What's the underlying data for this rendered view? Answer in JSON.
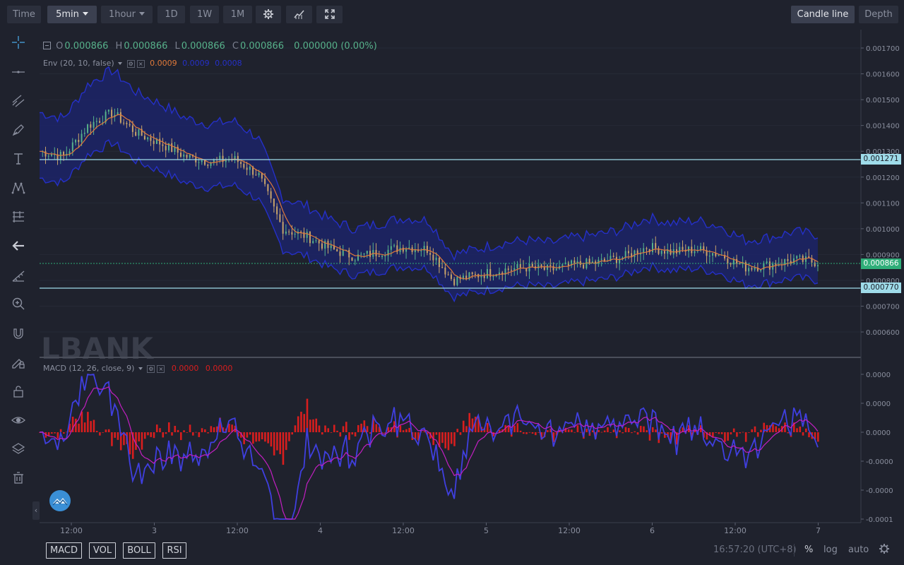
{
  "toolbar": {
    "time_label": "Time",
    "interval_active": "5min",
    "interval_hour": "1hour",
    "interval_1d": "1D",
    "interval_1w": "1W",
    "interval_1m": "1M",
    "candle_line_label": "Candle line",
    "depth_label": "Depth"
  },
  "legend": {
    "o_label": "O",
    "o_value": "0.000866",
    "h_label": "H",
    "h_value": "0.000866",
    "l_label": "L",
    "l_value": "0.000866",
    "c_label": "C",
    "c_value": "0.000866",
    "change": "0.000000 (0.00%)",
    "env_label": "Env (20, 10, false)",
    "env_value_1": "0.0009",
    "env_value_2": "0.0009",
    "env_value_3": "0.0008",
    "macd_label": "MACD (12, 26, close, 9)",
    "macd_value_1": "0.0000",
    "macd_value_2": "0.0000"
  },
  "price_axis": {
    "ticks": [
      "0.001700",
      "0.001600",
      "0.001500",
      "0.001400",
      "0.001300",
      "0.001200",
      "0.001100",
      "0.001000",
      "0.000900",
      "0.000800",
      "0.000700",
      "0.000600"
    ],
    "tag_upper": "0.001271",
    "tag_current": "0.000866",
    "tag_lower": "0.000770"
  },
  "macd_axis": {
    "ticks": [
      "0.0000",
      "0.0000",
      "0.0000",
      "-0.0000",
      "-0.0000",
      "-0.0001"
    ]
  },
  "time_axis": {
    "ticks": [
      "12:00",
      "3",
      "12:00",
      "4",
      "12:00",
      "5",
      "12:00",
      "6",
      "12:00",
      "7"
    ]
  },
  "watermark": "LBANK",
  "bottom": {
    "macd_btn": "MACD",
    "vol_btn": "VOL",
    "boll_btn": "BOLL",
    "rsi_btn": "RSI",
    "clock": "16:57:20 (UTC+8)",
    "percent": "%",
    "log": "log",
    "auto": "auto"
  },
  "colors": {
    "background": "#1f222d",
    "envelope_fill": "#1c2470",
    "envelope_line": "#2530c8",
    "price_up": "#57b28b",
    "price_down": "#c9a46a",
    "ma_line": "#e0793a",
    "macd_hist": "#d81e1e",
    "macd_line": "#3f3fe0",
    "signal_line": "#c21fc2",
    "hline": "#9fdcea",
    "current_price": "#2fae79"
  },
  "chart_data": {
    "type": "line",
    "pair_price_axis": {
      "min": 0.00055,
      "max": 0.00175,
      "log": false
    },
    "horizontal_lines": [
      0.001271,
      0.00077
    ],
    "current_price": 0.000866,
    "x": [
      "12:00",
      "",
      "3",
      "",
      "12:00",
      "",
      "4",
      "",
      "12:00",
      "",
      "5",
      "",
      "12:00",
      "",
      "6",
      "",
      "12:00",
      "",
      "7"
    ],
    "series": [
      {
        "values": [
          0.0013,
          0.00128,
          0.0014,
          0.00145,
          0.00137,
          0.00133,
          0.00128,
          0.00126,
          0.00127,
          0.00121,
          0.001,
          0.00097,
          0.00092,
          0.00089,
          0.00091,
          0.00093,
          0.00092,
          0.0008,
          0.00082,
          0.00084,
          0.00085,
          0.00084,
          0.00086,
          0.00087,
          0.00089,
          0.00093,
          0.00091,
          0.00092,
          0.0009,
          0.00085,
          0.00086,
          0.00088,
          0.00087
        ]
      }
    ]
  }
}
